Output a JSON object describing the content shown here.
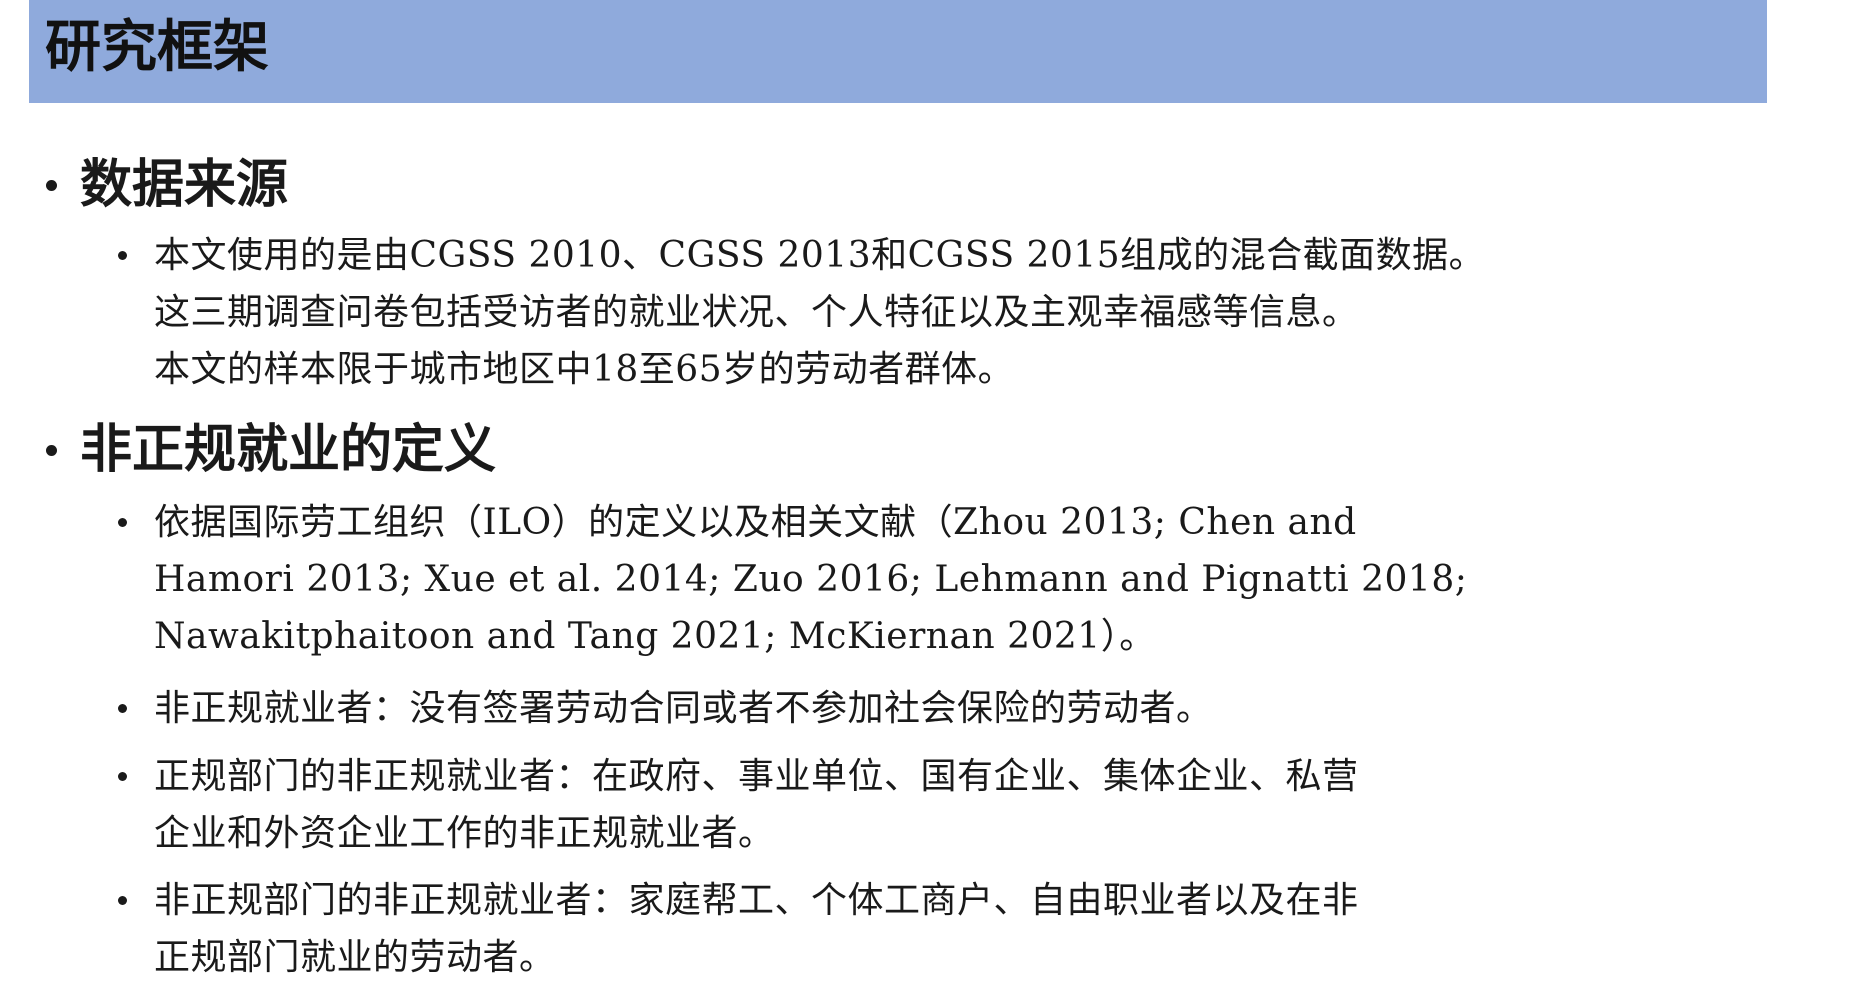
{
  "title": "研究框架",
  "sections": [
    {
      "heading": "数据来源",
      "items": [
        {
          "lines": [
            "本文使用的是由CGSS 2010、CGSS 2013和CGSS 2015组成的混合截面数据。",
            "这三期调查问卷包括受访者的就业状况、个人特征以及主观幸福感等信息。",
            "本文的样本限于城市地区中18至65岁的劳动者群体。"
          ]
        }
      ]
    },
    {
      "heading": "非正规就业的定义",
      "items": [
        {
          "lines": [
            "依据国际劳工组织（ILO）的定义以及相关文献（Zhou 2013; Chen and",
            "Hamori 2013; Xue et al. 2014; Zuo 2016; Lehmann and Pignatti 2018;",
            "Nawakitphaitoon and Tang 2021;  McKiernan 2021）。"
          ]
        },
        {
          "lines": [
            "非正规就业者：没有签署劳动合同或者不参加社会保险的劳动者。"
          ]
        },
        {
          "lines": [
            "正规部门的非正规就业者：在政府、事业单位、国有企业、集体企业、私营",
            "企业和外资企业工作的非正规就业者。"
          ]
        },
        {
          "lines": [
            "非正规部门的非正规就业者：家庭帮工、个体工商户、自由职业者以及在非",
            "正规部门就业的劳动者。"
          ]
        }
      ]
    }
  ]
}
